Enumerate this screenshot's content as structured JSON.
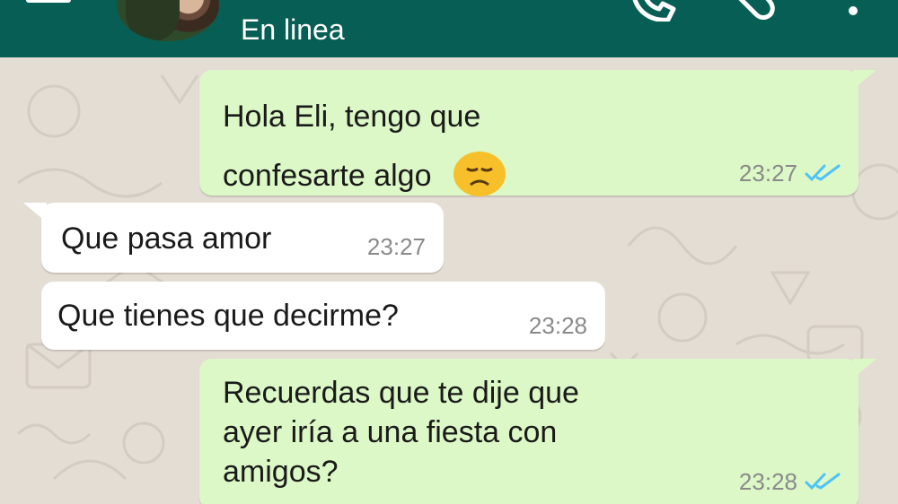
{
  "header": {
    "status": "En linea",
    "colors": {
      "bar": "#075e54",
      "text": "#ffffff"
    },
    "icons": [
      "back-arrow-icon",
      "avatar",
      "phone-icon",
      "paperclip-icon",
      "more-vert-icon"
    ]
  },
  "messages": [
    {
      "direction": "outgoing",
      "lines": [
        "Hola Eli, tengo que",
        "confesarte algo"
      ],
      "emoji": "disappointed-face-emoji",
      "time": "23:27",
      "read": true
    },
    {
      "direction": "incoming",
      "lines": [
        "Que pasa amor"
      ],
      "time": "23:27"
    },
    {
      "direction": "incoming",
      "lines": [
        "Que tienes que decirme?"
      ],
      "time": "23:28"
    },
    {
      "direction": "outgoing",
      "lines": [
        "Recuerdas que te dije que",
        "ayer iría a una fiesta con",
        "amigos?"
      ],
      "time": "23:28",
      "read": true
    }
  ],
  "colors": {
    "outgoing_bubble": "#dcf8c6",
    "incoming_bubble": "#ffffff",
    "chat_background": "#e4ddd4",
    "read_ticks": "#4fc3f7",
    "timestamp": "#8a8a8a"
  }
}
